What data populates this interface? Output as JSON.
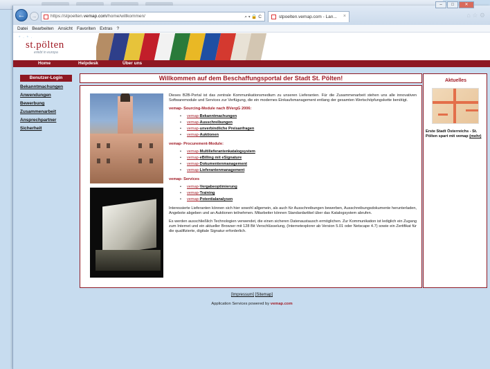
{
  "browser": {
    "url_prefix": "https://stpoelten.",
    "url_domain": "vemap.com",
    "url_path": "/home/willkommen/",
    "address_controls": "⌕ ▾ 🔒 C",
    "tab_title": "stpoelten.vemap.com - Lan...",
    "tab_close": "×",
    "menu": [
      "Datei",
      "Bearbeiten",
      "Ansicht",
      "Favoriten",
      "Extras",
      "?"
    ]
  },
  "site": {
    "logo_name": "st.pölten",
    "logo_tagline": "erlebt in europa",
    "nav": [
      "Home",
      "Helpdesk",
      "Über uns"
    ]
  },
  "sidebar": {
    "login_label": "Benutzer-Login",
    "items": [
      "Bekanntmachungen",
      "Anwendungen",
      "Bewerbung",
      "Zusammenarbeit",
      "Ansprechpartner",
      "Sicherheit"
    ]
  },
  "main": {
    "title": "Willkommen auf dem Beschaffungsportal der Stadt St. Pölten!",
    "intro": "Dieses B2B-Portal ist das zentrale Kommunikationsmedium zu unseren Lieferanten. Für die Zusammenarbeit stehen uns alle innovativen Softwaremodule und Services zur Verfügung, die ein modernes Einkaufsmanagement entlang der gesamten Wertschöpfungskette benötigt.",
    "section1_title": "vemap- Sourcing-Module nach BVergG 2006:",
    "section1_items": [
      {
        "prefix": "vemap-",
        "label": "Bekanntmachungen"
      },
      {
        "prefix": "vemap-",
        "label": "Ausschreibungen"
      },
      {
        "prefix": "vemap-",
        "label": "unverbindliche Preisanfragen"
      },
      {
        "prefix": "vemap-",
        "label": "Auktionen"
      }
    ],
    "section2_title": "vemap- Procurement-Module:",
    "section2_items": [
      {
        "prefix": "vemap-",
        "label": "Multilieferantenkatalogsystem"
      },
      {
        "prefix": "vemap-",
        "label": "eBilling mit eSignature"
      },
      {
        "prefix": "vemap-",
        "label": "Dokumentenmanagement"
      },
      {
        "prefix": "vemap-",
        "label": "Lieferantenmanagement"
      }
    ],
    "section3_title": "vemap- Services",
    "section3_items": [
      {
        "prefix": "vemap-",
        "label": "Vergabeoptimierung"
      },
      {
        "prefix": "vemap-",
        "label": "Training"
      },
      {
        "prefix": "vemap-",
        "label": "Potentialanalysen"
      }
    ],
    "para2": "Interessierte Lieferanten können sich hier sowohl allgemein, als auch für Ausschreibungen bewerben, Ausschreibungsdokumente herunterladen, Angebote abgeben und an Auktionen teilnehmen. Mitarbeiter können Standardartikel über das Katalogsystem abrufen.",
    "para3": "Es werden ausschließlich Technologien verwendet, die einen sicheren Datenaustausch ermöglichen. Zur Kommunikation ist lediglich ein Zugang zum Internet und ein aktueller Browser mit 128 Bit Verschlüsselung, (Internetexplorer ab Version 5.01 oder Netscape 4.7) sowie ein Zertifikat für die qualifizierte, digitale Signatur erforderlich."
  },
  "aside": {
    "title": "Aktuelles",
    "news_text": "Erste Stadt Österreichs - St. Pölten spart mit vemap",
    "news_more": "(mehr)"
  },
  "footer": {
    "impressum": "[Impressum]",
    "sitemap": "[Sitemap]",
    "powered_prefix": "Application Services powered by ",
    "powered_brand": "vemap.com"
  },
  "colors": {
    "brand_red": "#8e1722",
    "accent_red": "#a01a24",
    "page_bg": "#c7dcef"
  }
}
